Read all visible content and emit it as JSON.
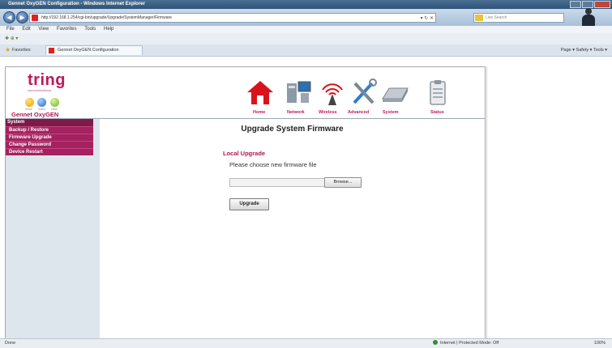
{
  "window": {
    "title": "Gennet OxyGEN Configuration - Windows Internet Explorer"
  },
  "browser": {
    "address": "http://192.168.1.254/cgi-bin/upgrade/Upgrade/SystemManager/Firmware",
    "search_placeholder": "Live Search",
    "menu": [
      "File",
      "Edit",
      "View",
      "Favorites",
      "Tools",
      "Help"
    ],
    "favorites_label": "Favorites",
    "tab_label": "Gennet OxyGEN Configuration",
    "tools_text": "Page ▾  Safety ▾  Tools ▾",
    "status_left": "Done",
    "status_zone": "Internet | Protected Mode: Off",
    "status_zoom": "100%"
  },
  "brand": {
    "logo": "tring",
    "logo_sub": "communications",
    "dot_labels": [
      "Voice",
      "Video",
      "Data"
    ],
    "product": "Gennet OxyGEN",
    "accent": "#b01553"
  },
  "nav": [
    {
      "label": "Home",
      "icon": "home-icon"
    },
    {
      "label": "Network",
      "icon": "network-icon"
    },
    {
      "label": "Wireless",
      "icon": "wireless-icon"
    },
    {
      "label": "Advanced",
      "icon": "tools-icon"
    },
    {
      "label": "System",
      "icon": "router-icon"
    },
    {
      "label": "Status",
      "icon": "clipboard-icon"
    }
  ],
  "sidebar": {
    "header": "System",
    "items": [
      "Backup / Restore",
      "Firmware Upgrade",
      "Change Password",
      "Device Restart"
    ]
  },
  "main": {
    "title": "Upgrade System Firmware",
    "section": "Local Upgrade",
    "prompt": "Please choose new firmware file",
    "file_value": "",
    "browse_label": "Browse...",
    "upgrade_label": "Upgrade"
  }
}
